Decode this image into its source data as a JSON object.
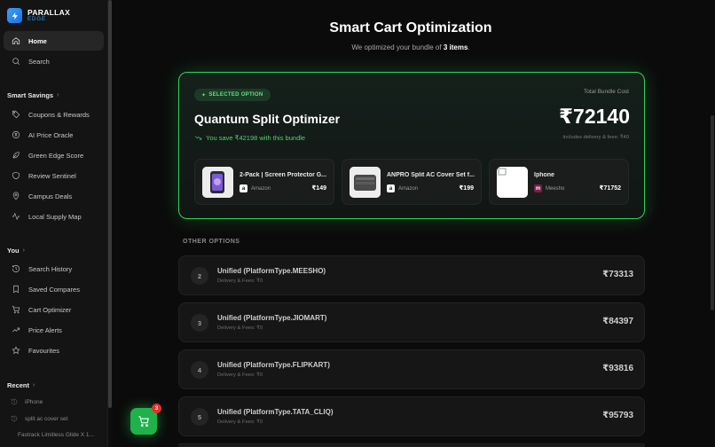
{
  "brand": {
    "name": "PARALLAX",
    "sub": "EDGE",
    "logo_icon": "bolt-icon"
  },
  "nav": {
    "home": "Home",
    "search": "Search"
  },
  "smart_savings": {
    "heading": "Smart Savings",
    "items": [
      {
        "label": "Coupons & Rewards",
        "icon": "tag-icon"
      },
      {
        "label": "AI Price Oracle",
        "icon": "coin-icon"
      },
      {
        "label": "Green Edge Score",
        "icon": "leaf-icon"
      },
      {
        "label": "Review Sentinel",
        "icon": "shield-icon"
      },
      {
        "label": "Campus Deals",
        "icon": "map-pin-icon"
      },
      {
        "label": "Local Supply Map",
        "icon": "activity-icon"
      }
    ]
  },
  "you": {
    "heading": "You",
    "items": [
      {
        "label": "Search History",
        "icon": "history-icon"
      },
      {
        "label": "Saved Compares",
        "icon": "bookmark-icon"
      },
      {
        "label": "Cart Optimizer",
        "icon": "cart-icon"
      },
      {
        "label": "Price Alerts",
        "icon": "trend-up-icon"
      },
      {
        "label": "Favourites",
        "icon": "star-icon"
      }
    ]
  },
  "recent": {
    "heading": "Recent",
    "items": [
      "iPhone",
      "split ac cover set",
      "Fastrack Limitless Glide X 1..."
    ]
  },
  "page": {
    "title": "Smart Cart Optimization",
    "subtitle_pre": "We optimized your bundle of ",
    "subtitle_count": "3 items",
    "subtitle_post": "."
  },
  "selected": {
    "badge": "SELECTED OPTION",
    "name": "Quantum Split Optimizer",
    "save_text": "You save ₹42198 with this bundle",
    "total_label": "Total Bundle Cost",
    "total_price": "₹72140",
    "total_note": "Includes delivery & fees: ₹40",
    "products": [
      {
        "name": "2-Pack | Screen Protector G...",
        "store": "Amazon",
        "store_letter": "a",
        "price": "₹149"
      },
      {
        "name": "ANPRO Split AC Cover Set f...",
        "store": "Amazon",
        "store_letter": "a",
        "price": "₹199"
      },
      {
        "name": "Iphone",
        "store": "Meesho",
        "store_letter": "m",
        "price": "₹71752"
      }
    ]
  },
  "other": {
    "heading": "OTHER OPTIONS",
    "options": [
      {
        "rank": "2",
        "name": "Unified (PlatformType.MEESHO)",
        "fee": "Delivery & Fees: ₹0",
        "price": "₹73313"
      },
      {
        "rank": "3",
        "name": "Unified (PlatformType.JIOMART)",
        "fee": "Delivery & Fees: ₹0",
        "price": "₹84397"
      },
      {
        "rank": "4",
        "name": "Unified (PlatformType.FLIPKART)",
        "fee": "Delivery & Fees: ₹0",
        "price": "₹93816"
      },
      {
        "rank": "5",
        "name": "Unified (PlatformType.TATA_CLIQ)",
        "fee": "Delivery & Fees: ₹0",
        "price": "₹95793"
      }
    ]
  },
  "cart": {
    "count": "3"
  },
  "colors": {
    "accent": "#2fd45b",
    "brand": "#3aa0ff",
    "badge": "#e0322e"
  }
}
